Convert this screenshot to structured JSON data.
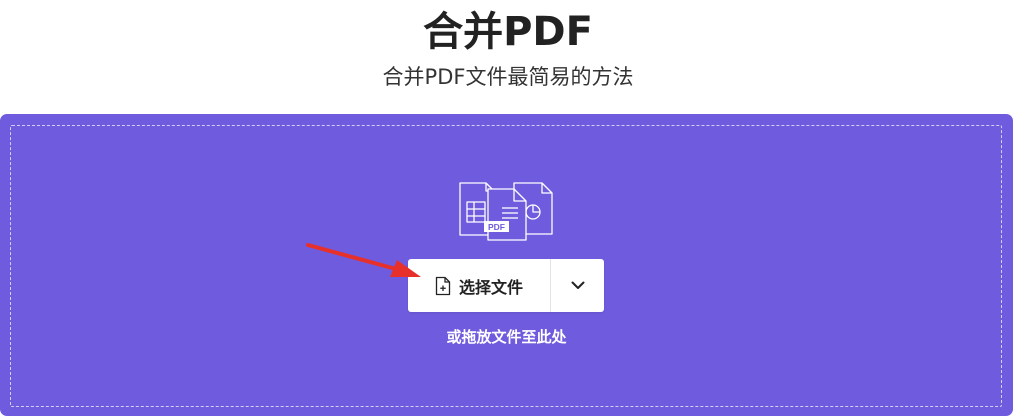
{
  "header": {
    "title": "合并PDF",
    "subtitle": "合并PDF文件最简易的方法"
  },
  "upload": {
    "select_button_label": "选择文件",
    "drag_hint": "或拖放文件至此处",
    "file_badge": "PDF"
  },
  "colors": {
    "panel_background": "#6f5bdd",
    "annotation_arrow": "#e8302a"
  },
  "icons": {
    "file_illustration": "stacked-files-icon",
    "select_file": "file-plus-icon",
    "dropdown": "chevron-down-icon",
    "annotation": "red-arrow"
  }
}
